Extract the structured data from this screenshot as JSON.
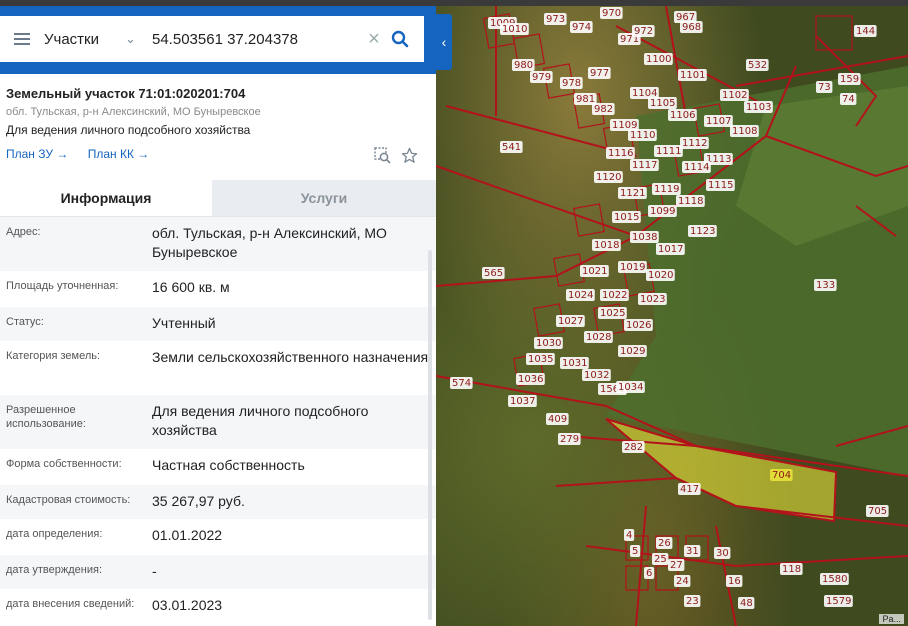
{
  "search": {
    "type_label": "Участки",
    "query": "54.503561 37.204378"
  },
  "parcel": {
    "title": "Земельный участок 71:01:020201:704",
    "region": "обл. Тульская, р-н Алексинский, МО Буныревское",
    "purpose": "Для ведения личного подсобного хозяйства",
    "plan_zu": "План ЗУ →",
    "plan_kk": "План КК →"
  },
  "tabs": {
    "info": "Информация",
    "services": "Услуги"
  },
  "rows": [
    {
      "label": "Адрес:",
      "value": "обл. Тульская, р-н Алексинский, МО Буныревское"
    },
    {
      "label": "Площадь уточненная:",
      "value": "16 600 кв. м"
    },
    {
      "label": "Статус:",
      "value": "Учтенный"
    },
    {
      "label": "Категория земель:",
      "value": "Земли сельскохозяйственного назначения"
    },
    {
      "label": "Разрешенное использование:",
      "value": "Для ведения личного подсобного хозяйства"
    },
    {
      "label": "Форма собственности:",
      "value": "Частная собственность"
    },
    {
      "label": "Кадастровая стоимость:",
      "value": "35 267,97 руб."
    },
    {
      "label": "дата определения:",
      "value": "01.01.2022"
    },
    {
      "label": "дата утверждения:",
      "value": "-"
    },
    {
      "label": "дата внесения сведений:",
      "value": "03.01.2023"
    }
  ],
  "map": {
    "labels": [
      "1009",
      "1010",
      "973",
      "974",
      "970",
      "971",
      "972",
      "967",
      "968",
      "532",
      "144",
      "980",
      "979",
      "978",
      "977",
      "1100",
      "1101",
      "159",
      "73",
      "74",
      "981",
      "982",
      "1104",
      "1105",
      "1106",
      "1102",
      "1103",
      "1107",
      "1108",
      "1109",
      "1110",
      "541",
      "1116",
      "1117",
      "1111",
      "1112",
      "1113",
      "1120",
      "1121",
      "1119",
      "1114",
      "1115",
      "1015",
      "1099",
      "1118",
      "1123",
      "1018",
      "1038",
      "1017",
      "1021",
      "1019",
      "1020",
      "565",
      "1024",
      "1022",
      "1023",
      "133",
      "1027",
      "1025",
      "1026",
      "1030",
      "1028",
      "1029",
      "1035",
      "1031",
      "1032",
      "1562",
      "1034",
      "1036",
      "574",
      "1037",
      "409",
      "279",
      "282",
      "704",
      "417",
      "705",
      "4",
      "5",
      "26",
      "25",
      "31",
      "30",
      "6",
      "24",
      "27",
      "16",
      "118",
      "1580",
      "23",
      "48",
      "1579"
    ],
    "highlight_label": "704",
    "attribution": "Pa..."
  },
  "colors": {
    "accent": "#1565c0",
    "parcel_line": "#b3121b",
    "highlight": "#e8e23a"
  }
}
